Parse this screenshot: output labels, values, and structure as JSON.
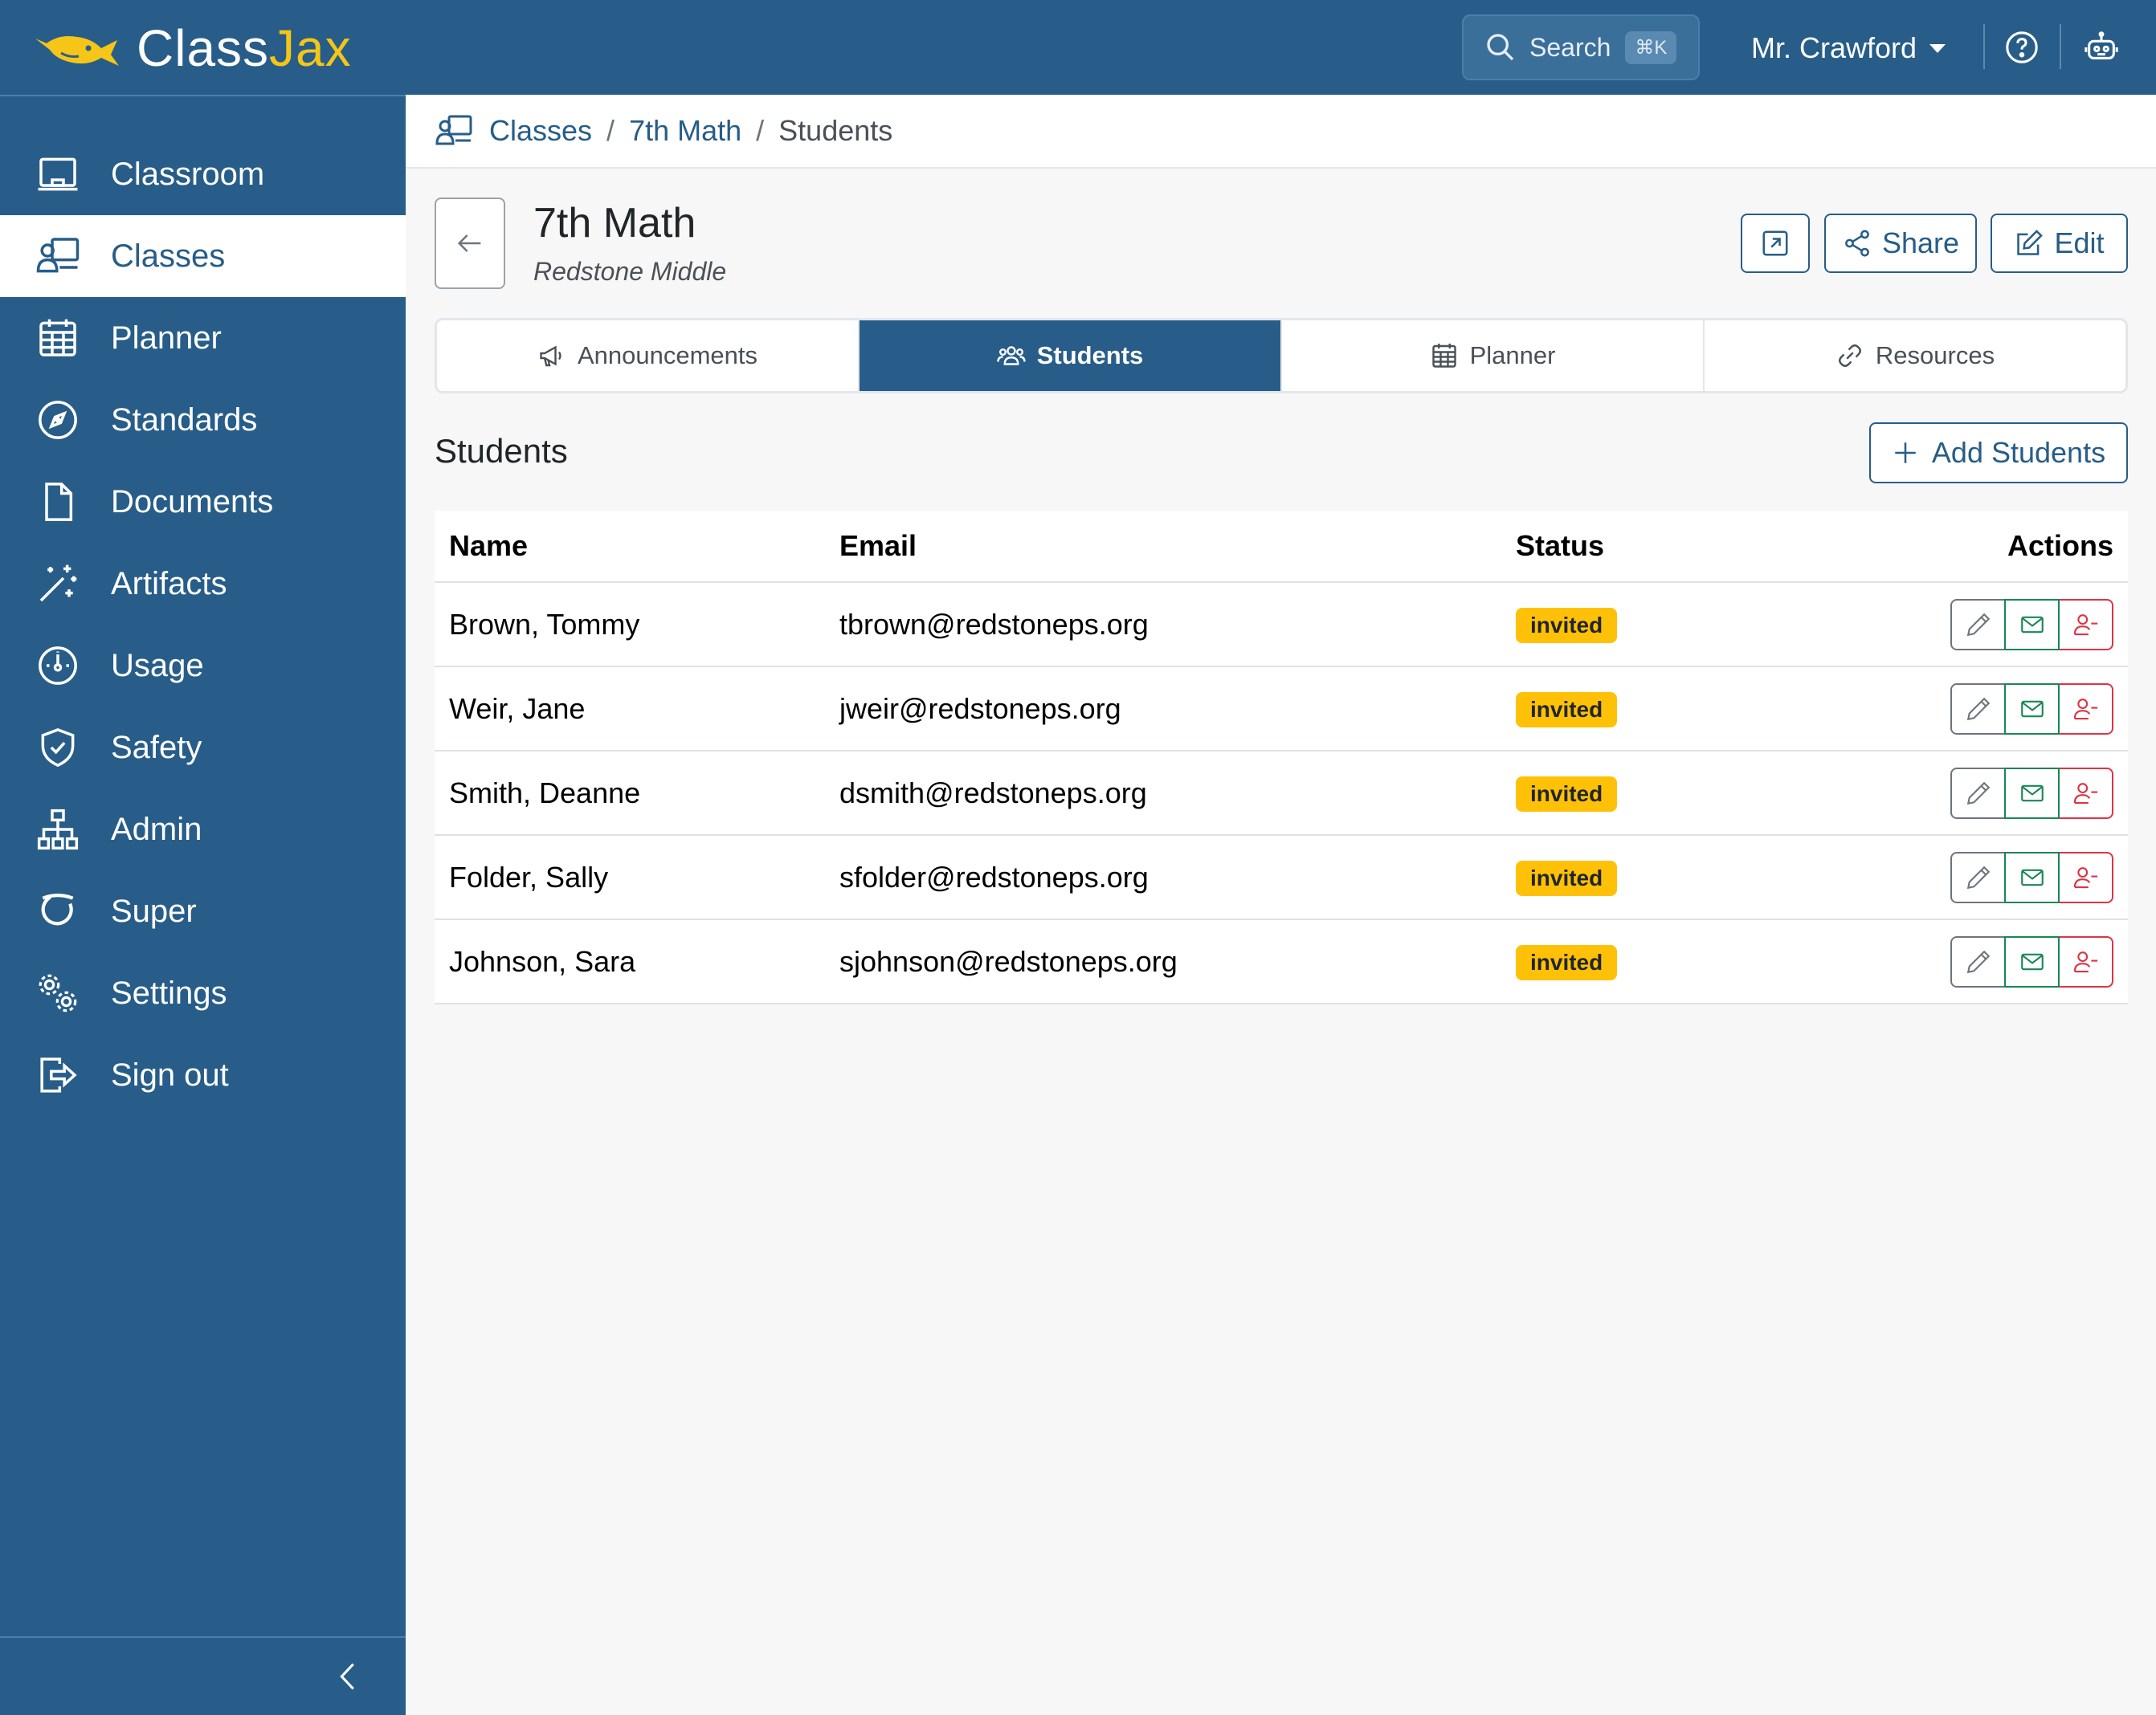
{
  "app": {
    "brand_prefix": "Class",
    "brand_suffix": "Jax",
    "logo_icon": "whale-logo"
  },
  "topbar": {
    "search_label": "Search",
    "search_shortcut": "⌘K",
    "user_name": "Mr. Crawford",
    "help_icon": "question-circle-icon",
    "assistant_icon": "robot-icon"
  },
  "sidebar": {
    "items": [
      {
        "label": "Classroom",
        "icon": "easel-icon"
      },
      {
        "label": "Classes",
        "icon": "person-video-icon"
      },
      {
        "label": "Planner",
        "icon": "calendar-grid-icon"
      },
      {
        "label": "Standards",
        "icon": "compass-icon"
      },
      {
        "label": "Documents",
        "icon": "file-icon"
      },
      {
        "label": "Artifacts",
        "icon": "magic-wand-icon"
      },
      {
        "label": "Usage",
        "icon": "speedometer-icon"
      },
      {
        "label": "Safety",
        "icon": "shield-check-icon"
      },
      {
        "label": "Admin",
        "icon": "diagram-icon"
      },
      {
        "label": "Super",
        "icon": "circle-swoosh-icon"
      },
      {
        "label": "Settings",
        "icon": "gears-icon"
      },
      {
        "label": "Sign out",
        "icon": "box-arrow-right-icon"
      }
    ],
    "active_index": 1
  },
  "breadcrumb": {
    "root": "Classes",
    "class": "7th Math",
    "current": "Students"
  },
  "class": {
    "title": "7th Math",
    "school": "Redstone Middle"
  },
  "header_buttons": {
    "share": "Share",
    "edit": "Edit"
  },
  "tabs": [
    {
      "label": "Announcements",
      "icon": "megaphone-icon"
    },
    {
      "label": "Students",
      "icon": "people-icon"
    },
    {
      "label": "Planner",
      "icon": "calendar-icon"
    },
    {
      "label": "Resources",
      "icon": "link-icon"
    }
  ],
  "active_tab": "Students",
  "students": {
    "title": "Students",
    "add_label": "Add Students",
    "columns": {
      "name": "Name",
      "email": "Email",
      "status": "Status",
      "actions": "Actions"
    },
    "rows": [
      {
        "name": "Brown, Tommy",
        "email": "tbrown@redstoneps.org",
        "status": "invited"
      },
      {
        "name": "Weir, Jane",
        "email": "jweir@redstoneps.org",
        "status": "invited"
      },
      {
        "name": "Smith, Deanne",
        "email": "dsmith@redstoneps.org",
        "status": "invited"
      },
      {
        "name": "Folder, Sally",
        "email": "sfolder@redstoneps.org",
        "status": "invited"
      },
      {
        "name": "Johnson, Sara",
        "email": "sjohnson@redstoneps.org",
        "status": "invited"
      }
    ]
  },
  "colors": {
    "primary": "#275d88",
    "accent_yellow": "#f5c518",
    "badge_warning": "#ffc107",
    "success": "#198754",
    "danger": "#dc3545"
  }
}
